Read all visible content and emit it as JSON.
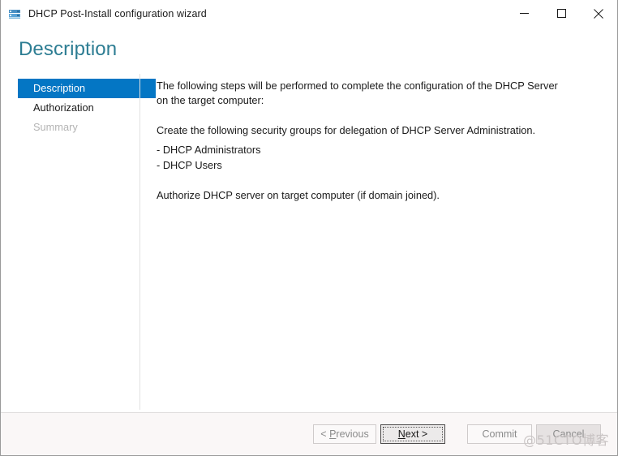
{
  "window": {
    "title": "DHCP Post-Install configuration wizard",
    "icon": "dhcp-server-icon",
    "controls": {
      "minimize": "minimize-icon",
      "maximize": "maximize-icon",
      "close": "close-icon"
    }
  },
  "page": {
    "heading": "Description",
    "heading_color": "#2d7d93"
  },
  "nav": {
    "items": [
      {
        "label": "Description",
        "state": "selected"
      },
      {
        "label": "Authorization",
        "state": "normal"
      },
      {
        "label": "Summary",
        "state": "disabled"
      }
    ],
    "selected_color": "#0476c4"
  },
  "content": {
    "intro": "The following steps will be performed to complete the configuration of the DHCP Server on the target computer:",
    "groups_heading": "Create the following security groups for delegation of DHCP Server Administration.",
    "groups": [
      "- DHCP Administrators",
      "- DHCP Users"
    ],
    "authorize": "Authorize DHCP server on target computer (if domain joined)."
  },
  "footer": {
    "buttons": [
      {
        "id": "previous",
        "label": "< Previous",
        "underline": "P",
        "state": "disabled"
      },
      {
        "id": "next",
        "label": "Next >",
        "underline": "N",
        "state": "focused"
      },
      {
        "id": "commit",
        "label": "Commit",
        "state": "disabled"
      },
      {
        "id": "cancel",
        "label": "Cancel",
        "state": "enabled"
      }
    ]
  },
  "watermark": {
    "text": "@51CTO博客"
  }
}
